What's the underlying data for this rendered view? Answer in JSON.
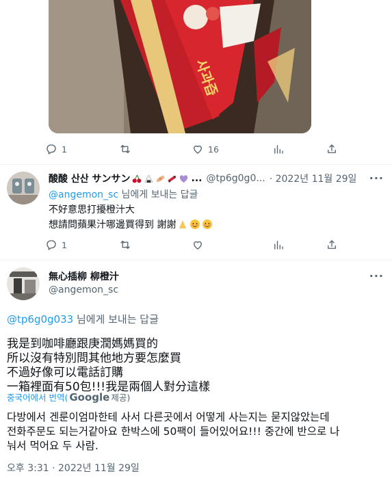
{
  "media": {
    "description_icon": "photo"
  },
  "top_actions": {
    "reply_count": "1",
    "retweet_count": "",
    "like_count": "16"
  },
  "reply_tweet": {
    "display_name": "酸酸 산산 サンサン",
    "emojis": [
      "cherry-emoji",
      "rice-ball-emoji",
      "bandage-emoji",
      "skateboard-emoji",
      "purple-heart-emoji"
    ],
    "ellipsis": "...",
    "handle": "@tp6g0g0...",
    "time": "· 2022년 11월 29일",
    "replying_mention": "@angemon_sc",
    "replying_suffix": " 님에게 보내는 답글",
    "lines": [
      "不好意思打擾橙汁大",
      "想請問蘋果汁哪邊買得到 謝謝"
    ],
    "line2_emojis": [
      "folded-hands-emoji",
      "smiling-emoji",
      "smiling-emoji"
    ],
    "actions": {
      "reply_count": "1"
    }
  },
  "main_tweet": {
    "display_name": "無心插柳 柳橙汁",
    "handle": "@angemon_sc",
    "replying_mention": "@tp6g0g033",
    "replying_suffix": " 님에게 보내는 답글",
    "lines": [
      "我是到咖啡廳跟庚潤媽媽買的",
      "所以沒有特別問其他地方要怎麼買",
      "不過好像可以電話訂購",
      "一箱裡面有50包!!!我是兩個人對分這樣"
    ],
    "translate_prefix": "중국어에서 번역(",
    "translate_brand": "Google",
    "translate_suffix": " 제공)",
    "translation_lines": [
      "다방에서 겐룬이엄마한테 사서 다른곳에서 어떻게 사는지는 묻지않았는데",
      "전화주문도 되는거같아요 한박스에 50팩이 들어있어요!!! 중간에 반으로 나",
      "눠서 먹어요 두 사람."
    ],
    "timestamp": "오후 3:31 · 2022년 11월 29일"
  },
  "colors": {
    "accent": "#1d9bf0",
    "muted": "#536471",
    "text": "#0f1419"
  }
}
